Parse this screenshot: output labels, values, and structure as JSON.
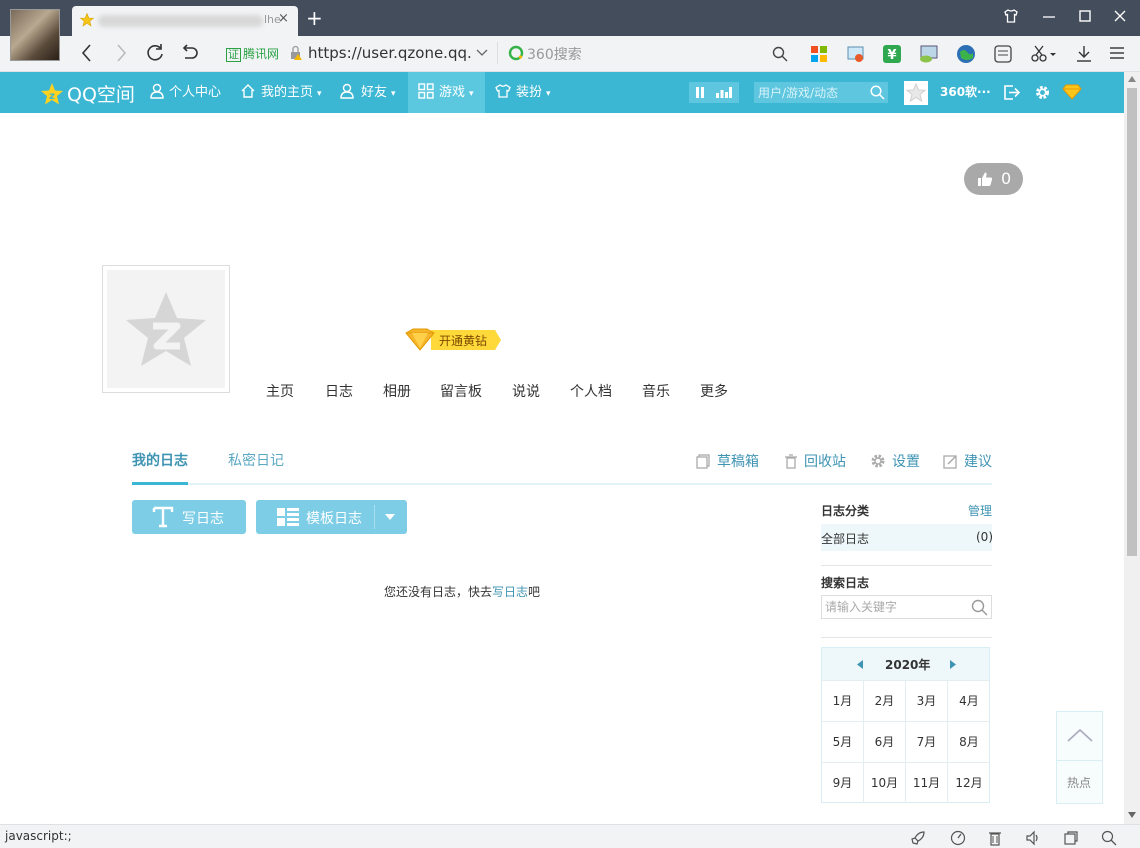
{
  "browser": {
    "tab_title": "",
    "tab_title_suffix": "lhe",
    "close_glyph": "×",
    "new_tab_glyph": "+",
    "cert_badge": "证",
    "cert_label": "腾讯网",
    "url": "https://user.qzone.qq.",
    "search_engine": "360搜索",
    "status_text": "javascript:;"
  },
  "qznav": {
    "logo": "QQ空间",
    "items": [
      {
        "label": "个人中心",
        "icon": "person-icon"
      },
      {
        "label": "我的主页",
        "icon": "home-icon",
        "dropdown": true
      },
      {
        "label": "好友",
        "icon": "friends-icon",
        "dropdown": true
      },
      {
        "label": "游戏",
        "icon": "grid-icon",
        "dropdown": true,
        "active": true
      },
      {
        "label": "装扮",
        "icon": "shirt-icon",
        "dropdown": true
      }
    ],
    "search_placeholder": "用户/游戏/动态",
    "username": "360软···",
    "accent": "#3bb6d3"
  },
  "profile": {
    "like_count": "0",
    "yellow_diamond_label": "开通黄钻",
    "nav": [
      "主页",
      "日志",
      "相册",
      "留言板",
      "说说",
      "个人档",
      "音乐",
      "更多"
    ]
  },
  "blog": {
    "tabs": [
      "我的日志",
      "私密日记"
    ],
    "tools": [
      "草稿箱",
      "回收站",
      "设置",
      "建议"
    ],
    "write_button": "写日志",
    "template_button": "模板日志",
    "empty_prefix": "您还没有日志，快去",
    "empty_link": "写日志",
    "empty_suffix": "吧"
  },
  "sidebar": {
    "category_title": "日志分类",
    "manage_label": "管理",
    "all_blogs_label": "全部日志",
    "all_blogs_count": "(0)",
    "search_title": "搜索日志",
    "search_placeholder": "请输入关键字",
    "calendar_year": "2020年",
    "months": [
      "1月",
      "2月",
      "3月",
      "4月",
      "5月",
      "6月",
      "7月",
      "8月",
      "9月",
      "10月",
      "11月",
      "12月"
    ],
    "hot_label": "热点"
  }
}
